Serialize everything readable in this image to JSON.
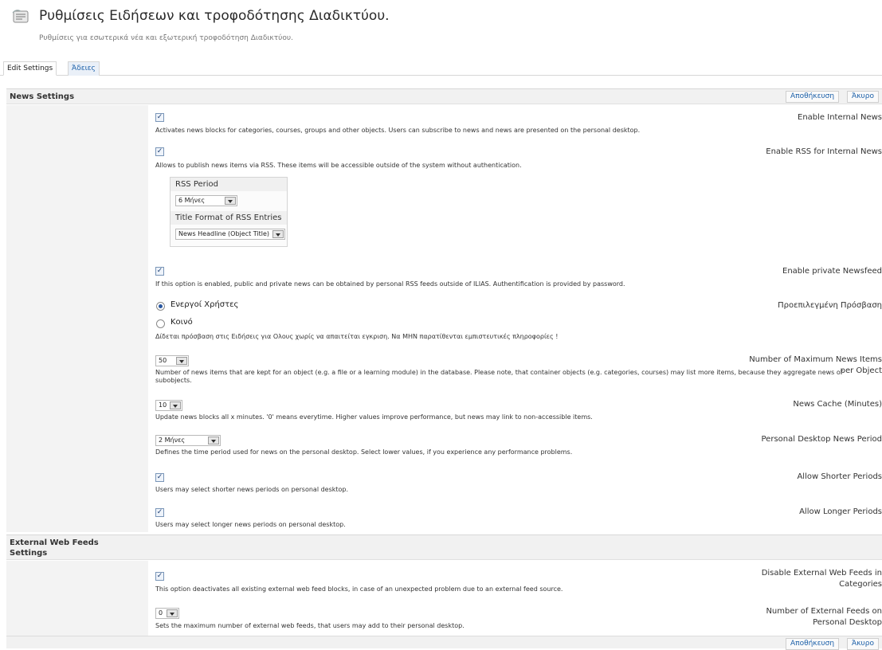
{
  "header": {
    "title": "Ρυθμίσεις Ειδήσεων και τροφοδότησης Διαδικτύου.",
    "description": "Ρυθμίσεις για εσωτερικά νέα και εξωτερική τροφοδότηση Διαδικτύου.",
    "icon": "news-settings-icon"
  },
  "tabs": [
    {
      "label": "Edit Settings"
    },
    {
      "label": "Άδειες"
    }
  ],
  "buttons": {
    "save": "Αποθήκευση",
    "cancel": "Άκυρο"
  },
  "sections": {
    "news": "News Settings",
    "external": "External Web Feeds Settings"
  },
  "fields": {
    "enable_internal_news": {
      "label": "Enable Internal News",
      "checked": true,
      "info": "Activates news blocks for categories, courses, groups and other objects. Users can subscribe to news and news are presented on the personal desktop."
    },
    "enable_rss": {
      "label": "Enable RSS for Internal News",
      "checked": true,
      "info": "Allows to publish news items via RSS. These items will be accessible outside of the system without authentication.",
      "rss_period_label": "RSS Period",
      "rss_period_value": "6 Μήνες",
      "title_format_label": "Title Format of RSS Entries",
      "title_format_value": "News Headline (Object Title)"
    },
    "private_newsfeed": {
      "label": "Enable private Newsfeed",
      "checked": true,
      "info": "If this option is enabled, public and private news can be obtained by personal RSS feeds outside of ILIAS. Authentification is provided by password."
    },
    "default_access": {
      "label": "Προεπιλεγμένη Πρόσβαση",
      "option1": "Ενεργοί Χρήστες",
      "option2": "Κοινό",
      "selected": "option1",
      "info": "Δίδεται πρόσβαση στις Ειδήσεις για Ολους χωρίς να απαιτείται εγκριση. Να ΜΗΝ παρατίθενται εμπιστευτικές πληροφορίες !"
    },
    "max_news": {
      "label": "Number of Maximum News Items per Object",
      "value": "50",
      "info": "Number of news items that are kept for an object (e.g. a file or a learning module) in the database. Please note, that container objects (e.g. categories, courses) may list more items, because they aggregate news of subobjects."
    },
    "news_cache": {
      "label": "News Cache (Minutes)",
      "value": "10",
      "info": "Update news blocks all x minutes. '0' means everytime. Higher values improve performance, but news may link to non-accessible items."
    },
    "pd_period": {
      "label": "Personal Desktop News Period",
      "value": "2 Μήνες",
      "info": "Defines the time period used for news on the personal desktop. Select lower values, if you experience any performance problems."
    },
    "allow_shorter": {
      "label": "Allow Shorter Periods",
      "checked": true,
      "info": "Users may select shorter news periods on personal desktop."
    },
    "allow_longer": {
      "label": "Allow Longer Periods",
      "checked": true,
      "info": "Users may select longer news periods on personal desktop."
    },
    "disable_external": {
      "label": "Disable External Web Feeds in Categories",
      "checked": true,
      "info": "This option deactivates all existing external web feed blocks, in case of an unexpected problem due to an external feed source."
    },
    "num_external": {
      "label": "Number of External Feeds on Personal Desktop",
      "value": "0",
      "info": "Sets the maximum number of external web feeds, that users may add to their personal desktop."
    }
  }
}
